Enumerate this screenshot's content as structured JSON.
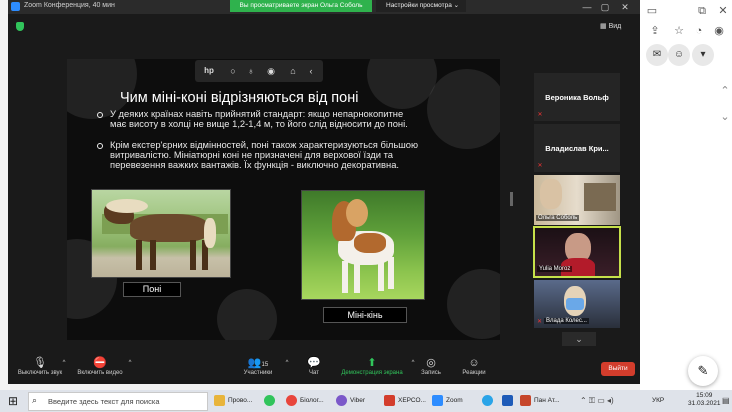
{
  "zoom": {
    "title": "Zoom Конференция, 40 мин",
    "share_banner": "Вы просматриваете экран Ольга Соболь",
    "view_options": "Настройки просмотра ⌄",
    "view_button": "Вид"
  },
  "slide": {
    "title": "Чим міні-коні відрізняються від поні",
    "bullets": [
      "У деяких країнах навіть прийнятий стандарт: якщо непарнокопитне має висоту в холці не вище 1,2-1,4 м, то його слід відносити до поні.",
      "Крім екстер'єрних відмінностей, поні також характеризуються більшою витривалістю. Мініатюрні коні не призначені для верхової їзди та перевезення важких вантажів. Їх функція - виключно декоративна."
    ],
    "caption_left": "Поні",
    "caption_right": "Міні-кінь"
  },
  "participants": [
    {
      "name": "Вероника Вольф"
    },
    {
      "name": "Владислав Кри..."
    },
    {
      "name": "Ольга Соболь"
    },
    {
      "name": "Yulia Moroz"
    },
    {
      "name": "Влада Колес..."
    }
  ],
  "toolbar": {
    "mute": "Выключить звук",
    "video": "Включить видео",
    "participants": "Участники",
    "participants_count": "15",
    "chat": "Чат",
    "share": "Демонстрация экрана",
    "record": "Запись",
    "reactions": "Реакции",
    "end": "Выйти"
  },
  "taskbar": {
    "search_placeholder": "Введите здесь текст для поиска",
    "apps": [
      "Прово...",
      "Біолог...",
      "Viber",
      "ХЕРСО...",
      "Zoom",
      "Пан Ат..."
    ],
    "lang": "УКР",
    "time": "15:09",
    "date": "31.03.2021"
  },
  "colors": {
    "zoom_blue": "#2d8cff",
    "share_green": "#2fb24d",
    "end_red": "#d33d2c",
    "active_speaker": "#c6e04a"
  }
}
